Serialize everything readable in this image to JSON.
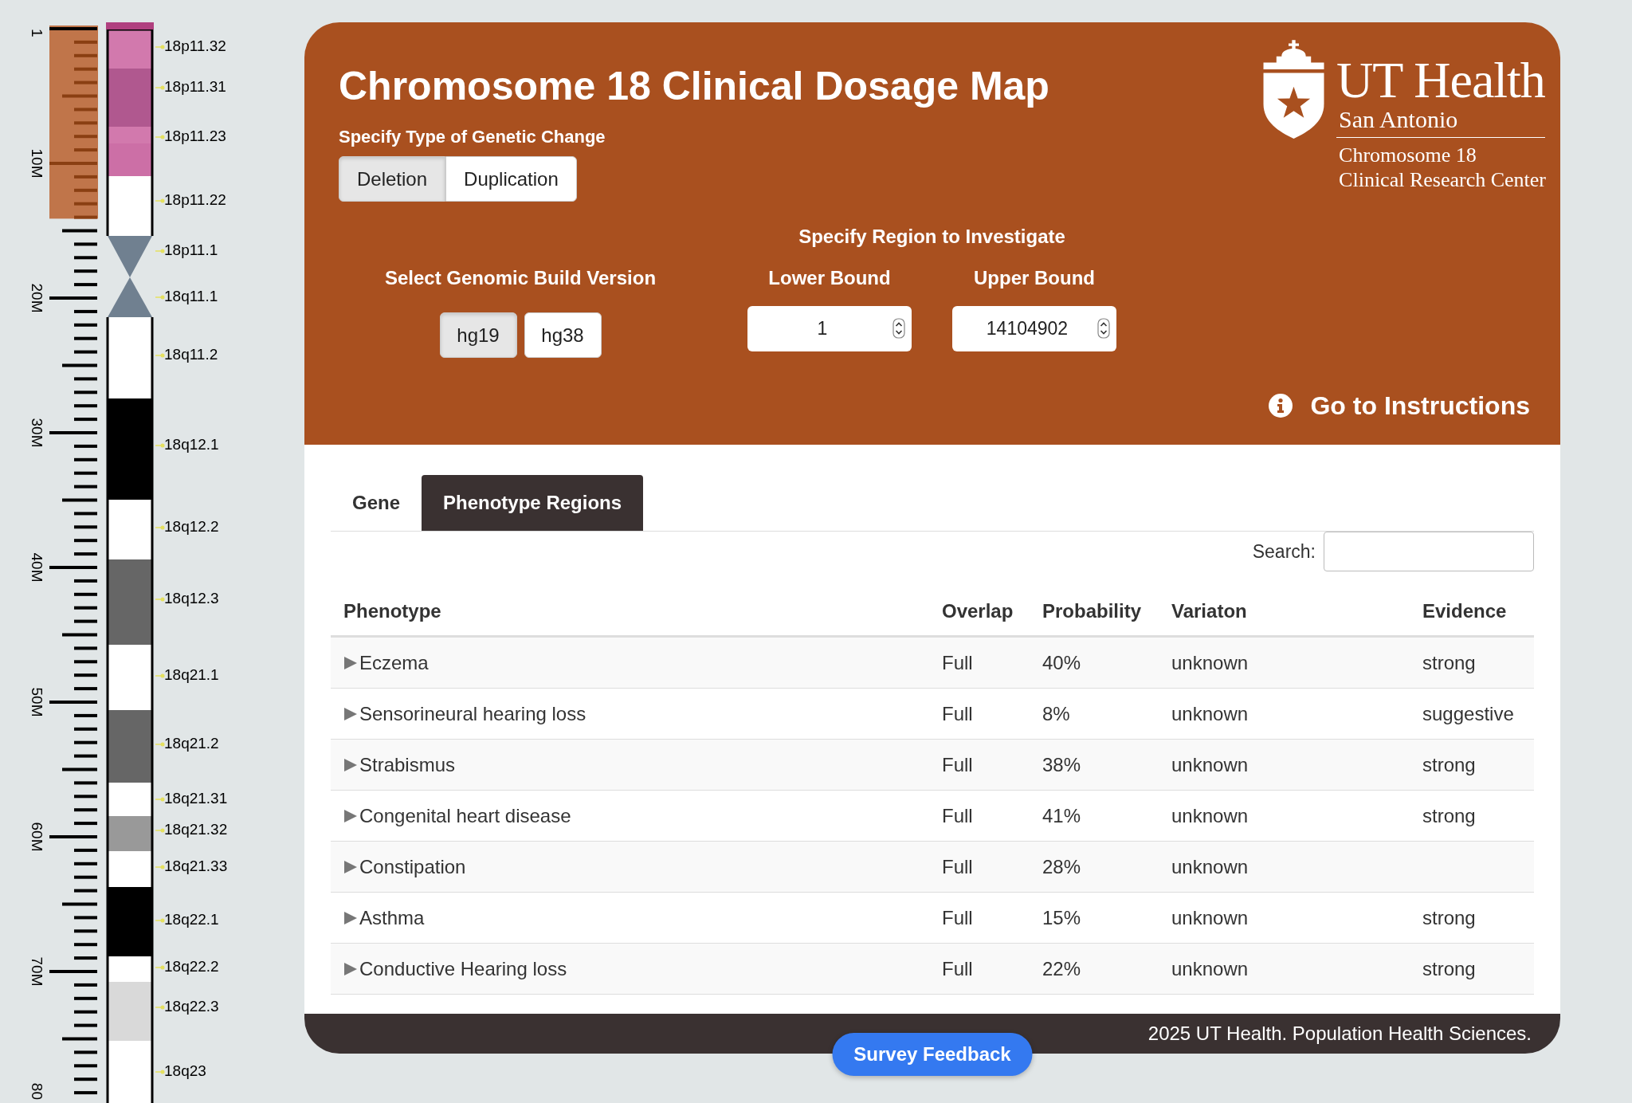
{
  "ideogram": {
    "axis_labels": [
      "1",
      "10M",
      "20M",
      "30M",
      "40M",
      "50M",
      "60M",
      "70M",
      "80"
    ],
    "bands": [
      {
        "label": "18p11.32",
        "color": "#d279ad",
        "kind": "band"
      },
      {
        "label": "18p11.31",
        "color": "#b0588f",
        "kind": "band"
      },
      {
        "label": "18p11.23",
        "color": "#d279ad",
        "kind": "band"
      },
      {
        "label": "18p11.22",
        "color": "#cc6fa6",
        "kind": "band"
      },
      {
        "label": "18p11.1",
        "color": "#708090",
        "kind": "centromere"
      },
      {
        "label": "18q11.1",
        "color": "#708090",
        "kind": "centromere"
      },
      {
        "label": "18q11.2",
        "color": "#ffffff",
        "kind": "band"
      },
      {
        "label": "18q12.1",
        "color": "#000000",
        "kind": "band"
      },
      {
        "label": "18q12.2",
        "color": "#ffffff",
        "kind": "band"
      },
      {
        "label": "18q12.3",
        "color": "#666666",
        "kind": "band"
      },
      {
        "label": "18q21.1",
        "color": "#ffffff",
        "kind": "band"
      },
      {
        "label": "18q21.2",
        "color": "#666666",
        "kind": "band"
      },
      {
        "label": "18q21.31",
        "color": "#ffffff",
        "kind": "band"
      },
      {
        "label": "18q21.32",
        "color": "#999999",
        "kind": "band"
      },
      {
        "label": "18q21.33",
        "color": "#ffffff",
        "kind": "band"
      },
      {
        "label": "18q22.1",
        "color": "#000000",
        "kind": "band"
      },
      {
        "label": "18q22.2",
        "color": "#ffffff",
        "kind": "band"
      },
      {
        "label": "18q22.3",
        "color": "#d9d9d9",
        "kind": "band"
      },
      {
        "label": "18q23",
        "color": "#ffffff",
        "kind": "band"
      }
    ]
  },
  "header": {
    "title": "Chromosome 18 Clinical Dosage Map",
    "change_type": {
      "label": "Specify Type of Genetic Change",
      "options": [
        {
          "label": "Deletion",
          "selected": true
        },
        {
          "label": "Duplication",
          "selected": false
        }
      ]
    },
    "build": {
      "label": "Select Genomic Build Version",
      "options": [
        {
          "label": "hg19",
          "selected": true
        },
        {
          "label": "hg38",
          "selected": false
        }
      ]
    },
    "region": {
      "label": "Specify Region to Investigate",
      "lower": {
        "label": "Lower Bound",
        "value": "1"
      },
      "upper": {
        "label": "Upper Bound",
        "value": "14104902"
      }
    },
    "logo": {
      "name": "UT Health",
      "subtitle": "San Antonio",
      "lines": [
        "Chromosome 18",
        "Clinical Research Center"
      ]
    },
    "instructions_link": "Go to Instructions"
  },
  "tabs": [
    {
      "label": "Gene",
      "selected": false
    },
    {
      "label": "Phenotype Regions",
      "selected": true
    }
  ],
  "search": {
    "label": "Search:"
  },
  "table": {
    "columns": [
      "Phenotype",
      "Overlap",
      "Probability",
      "Variaton",
      "Evidence"
    ],
    "rows": [
      {
        "phenotype": "Eczema",
        "overlap": "Full",
        "probability": "40%",
        "variation": "unknown",
        "evidence": "strong"
      },
      {
        "phenotype": "Sensorineural hearing loss",
        "overlap": "Full",
        "probability": "8%",
        "variation": "unknown",
        "evidence": "suggestive"
      },
      {
        "phenotype": "Strabismus",
        "overlap": "Full",
        "probability": "38%",
        "variation": "unknown",
        "evidence": "strong"
      },
      {
        "phenotype": "Congenital heart disease",
        "overlap": "Full",
        "probability": "41%",
        "variation": "unknown",
        "evidence": "strong"
      },
      {
        "phenotype": "Constipation",
        "overlap": "Full",
        "probability": "28%",
        "variation": "unknown"
      },
      {
        "phenotype": "Asthma",
        "overlap": "Full",
        "probability": "15%",
        "variation": "unknown",
        "evidence": "strong"
      },
      {
        "phenotype": "Conductive Hearing loss",
        "overlap": "Full",
        "probability": "22%",
        "variation": "unknown",
        "evidence": "strong"
      }
    ]
  },
  "footer": {
    "text": "2025 UT Health. Population Health Sciences."
  },
  "feedback_button": "Survey Feedback"
}
